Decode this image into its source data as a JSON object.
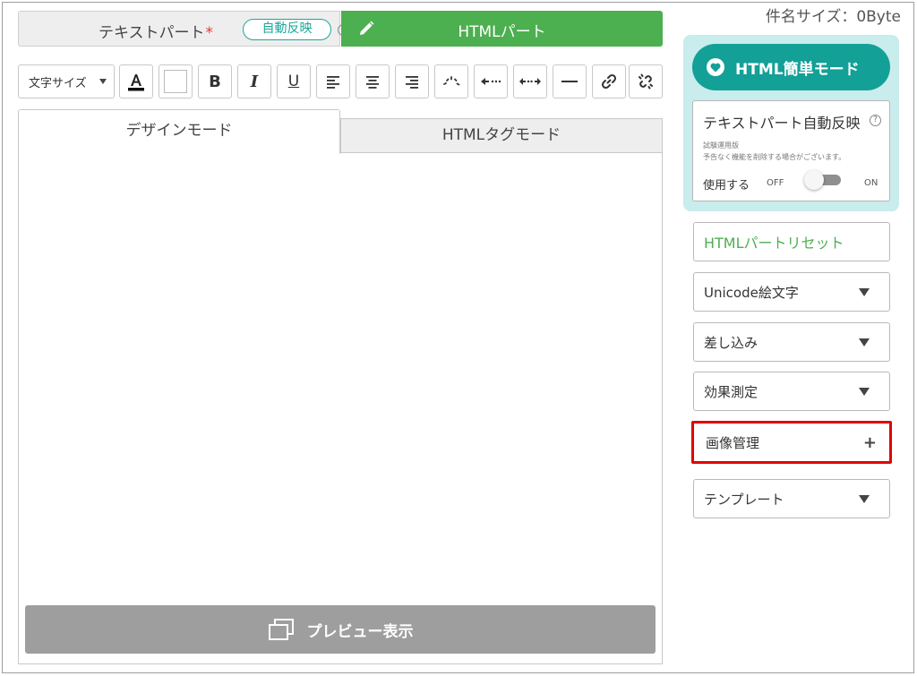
{
  "header": {
    "text_part_label": "テキストパート",
    "required_mark": "*",
    "auto_reflect_badge": "自動反映",
    "html_part_label": "HTMLパート",
    "subject_size": "件名サイズ：0Byte"
  },
  "toolbar": {
    "font_size_select": "文字サイズ",
    "bold": "B",
    "italic": "I",
    "underline": "U"
  },
  "editor": {
    "design_mode_tab": "デザインモード",
    "html_tag_mode_tab": "HTMLタグモード",
    "preview_button": "プレビュー表示"
  },
  "sidebar": {
    "easy_mode_button": "HTML簡単モード",
    "auto_reflect_title": "テキストパート自動反映",
    "trial_note": "試験運用版",
    "warning_note": "予告なく機能を削除する場合がございます。",
    "use_label": "使用する",
    "toggle_off": "OFF",
    "toggle_on": "ON",
    "toggle_state": false,
    "reset_button": "HTMLパートリセット",
    "unicode_emoji": "Unicode絵文字",
    "insert": "差し込み",
    "effect_measurement": "効果測定",
    "image_management": "画像管理",
    "template": "テンプレート"
  },
  "colors": {
    "green": "#4caf50",
    "teal": "#13a097",
    "teal_light": "#c9ecec",
    "highlight_red": "#e30000",
    "gray_button": "#9e9e9e"
  }
}
